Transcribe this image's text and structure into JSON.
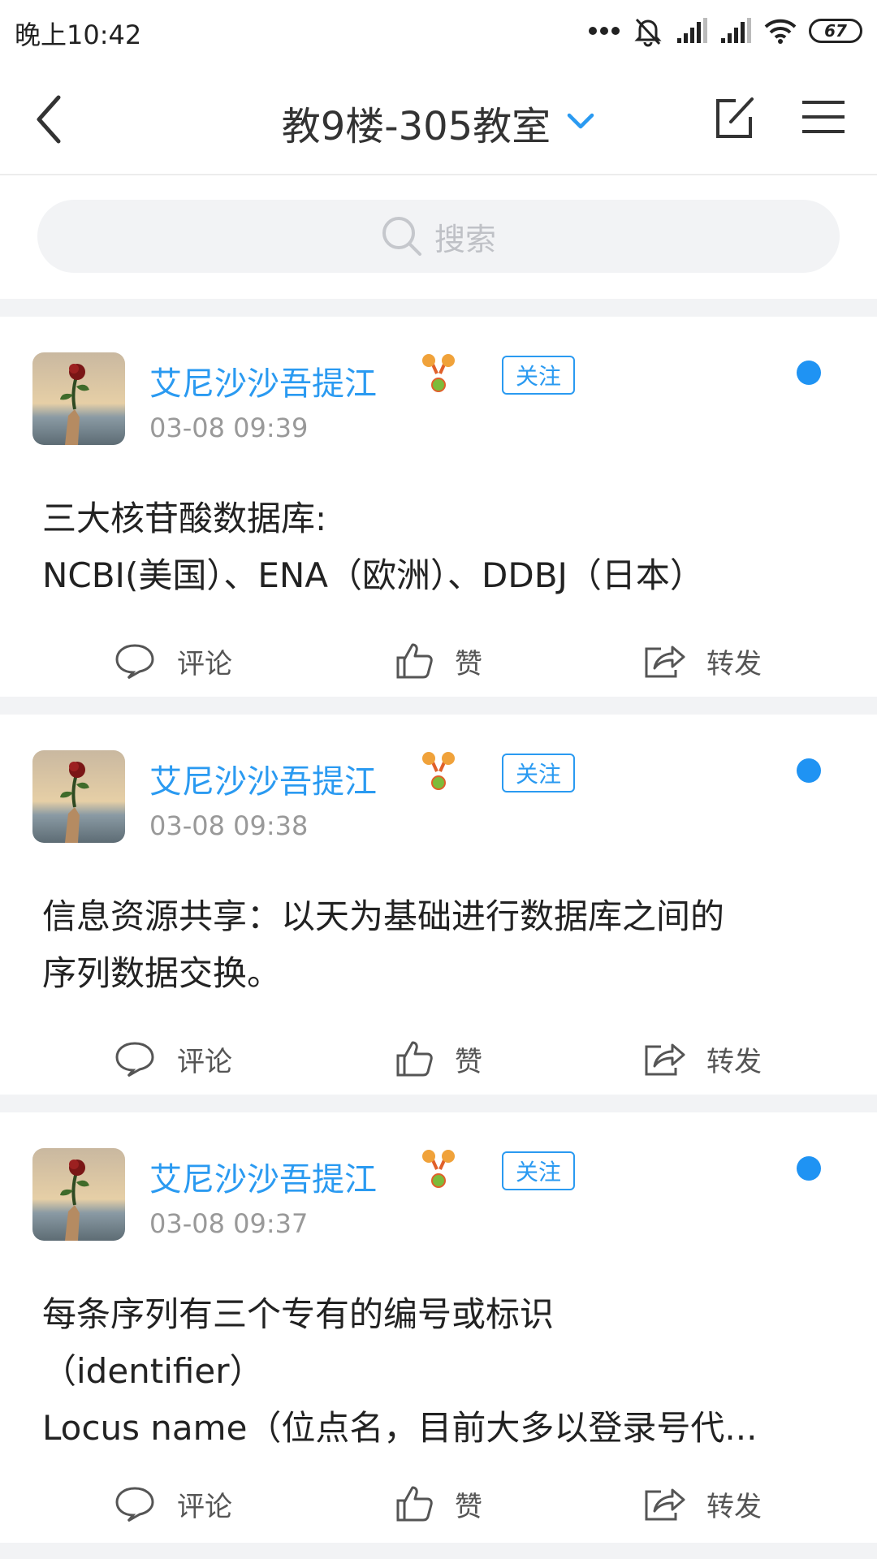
{
  "status_bar": {
    "time": "晚上10:42",
    "battery": "67",
    "icons": [
      "more-dots-icon",
      "alarm-off-icon",
      "signal-icon",
      "signal-icon",
      "wifi-icon",
      "battery-icon"
    ]
  },
  "nav": {
    "title": "教9楼-305教室",
    "back_icon": "chevron-left-icon",
    "title_icon": "chevron-down-icon",
    "edit_icon": "edit-icon",
    "menu_icon": "menu-icon"
  },
  "search": {
    "placeholder": "搜索"
  },
  "colors": {
    "accent": "#2a9af1",
    "dot": "#1f93f3",
    "divider": "#f2f3f5",
    "muted": "#999999"
  },
  "posts": [
    {
      "author": "艾尼沙沙吾提江",
      "follow": "关注",
      "time": "03-08 09:39",
      "content": "三大核苷酸数据库:\nNCBI(美国）、ENA（欧洲）、DDBJ（日本）",
      "comment": "评论",
      "like": "赞",
      "share": "转发"
    },
    {
      "author": "艾尼沙沙吾提江",
      "follow": "关注",
      "time": "03-08 09:38",
      "content": "信息资源共享：以天为基础进行数据库之间的\n序列数据交换。",
      "comment": "评论",
      "like": "赞",
      "share": "转发"
    },
    {
      "author": "艾尼沙沙吾提江",
      "follow": "关注",
      "time": "03-08 09:37",
      "content": "每条序列有三个专有的编号或标识\n（identifier）\nLocus name（位点名，目前大多以登录号代...",
      "comment": "评论",
      "like": "赞",
      "share": "转发"
    }
  ]
}
